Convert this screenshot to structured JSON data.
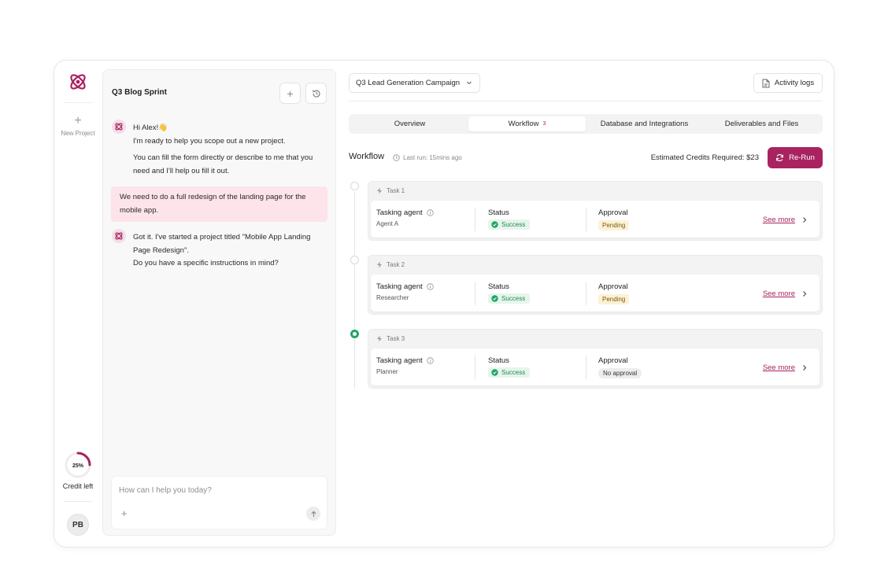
{
  "rail": {
    "new_project_label": "New Project",
    "credit_percent": 25,
    "credit_percent_label": "25%",
    "credit_label": "Credit left",
    "avatar_initials": "PB"
  },
  "chat": {
    "title": "Q3 Blog Sprint",
    "messages": [
      {
        "role": "bot",
        "lines": [
          "Hi Alex!👋",
          "I'm ready to help you scope out a new project.",
          "You can fill the form directly or describe to me that you need and I'll help ou fill it out."
        ]
      },
      {
        "role": "user",
        "text": "We need to do a full redesign of the landing page for the mobile app."
      },
      {
        "role": "bot",
        "lines": [
          "Got it. I've started a project titled \"Mobile App Landing Page Redesign\".",
          "Do you have a specific instructions in mind?"
        ]
      }
    ],
    "input_placeholder": "How can I help you today?"
  },
  "header": {
    "campaign": "Q3 Lead Generation Campaign",
    "activity_logs": "Activity logs"
  },
  "tabs": [
    {
      "label": "Overview",
      "active": false,
      "count": ""
    },
    {
      "label": "Workflow",
      "active": true,
      "count": "3"
    },
    {
      "label": "Database and Integrations",
      "active": false,
      "count": ""
    },
    {
      "label": "Deliverables and Files",
      "active": false,
      "count": ""
    }
  ],
  "workflow": {
    "heading": "Workflow",
    "last_run": "Last run: 15mins ago",
    "credits": "Estimated Credits Required: $23",
    "rerun": "Re-Run",
    "col_agent": "Tasking agent",
    "col_status": "Status",
    "col_approval": "Approval",
    "see_more": "See more",
    "tasks": [
      {
        "name": "Task 1",
        "agent": "Agent A",
        "status": "Success",
        "approval": "Pending",
        "done": false
      },
      {
        "name": "Task 2",
        "agent": "Researcher",
        "status": "Success",
        "approval": "Pending",
        "done": false
      },
      {
        "name": "Task 3",
        "agent": "Planner",
        "status": "Success",
        "approval": "No approval",
        "done": true
      }
    ]
  },
  "colors": {
    "brand": "#a8235f",
    "success": "#22a565",
    "user_bubble": "#fce4ea"
  }
}
